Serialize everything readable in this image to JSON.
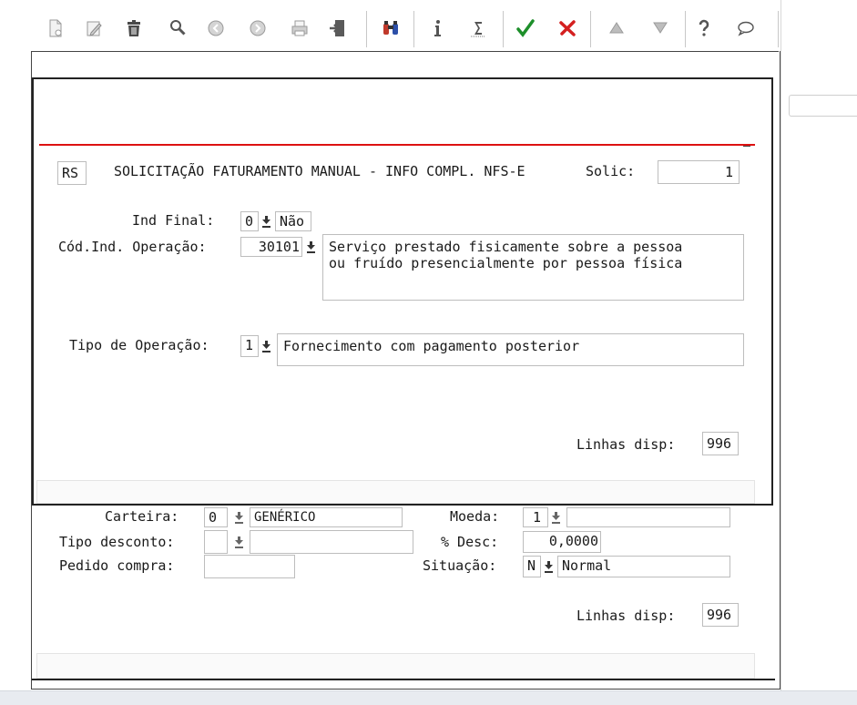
{
  "toolbar": {
    "icons": [
      "new-document-icon",
      "edit-icon",
      "trash-icon",
      "search-icon",
      "previous-icon",
      "next-icon",
      "print-icon",
      "exit-icon",
      "find-binoculars-icon",
      "info-icon",
      "sum-icon",
      "confirm-icon",
      "cancel-icon",
      "up-icon",
      "down-icon",
      "help-icon",
      "comment-icon"
    ]
  },
  "colors": {
    "accent_red": "#dd1111",
    "confirm_green": "#1d8f2a",
    "cancel_red": "#d42020"
  },
  "header": {
    "code": "RS",
    "title": "SOLICITAÇÃO FATURAMENTO MANUAL - INFO COMPL. NFS-E",
    "solic_label": "Solic:",
    "solic_value": "1"
  },
  "form": {
    "ind_final_label": "Ind Final:",
    "ind_final_code": "0",
    "ind_final_desc": "Não",
    "cod_ind_label": "Cód.Ind. Operação:",
    "cod_ind_value": "30101",
    "cod_ind_desc": "Serviço prestado fisicamente sobre a pessoa\nou fruído presencialmente por pessoa física",
    "tipo_op_label": "Tipo de Operação:",
    "tipo_op_code": "1",
    "tipo_op_desc": "Fornecimento com pagamento posterior",
    "linhas_label": "Linhas disp:",
    "linhas_value": "996"
  },
  "lower": {
    "carteira_label": "Carteira:",
    "carteira_code": "0",
    "carteira_desc": "GENÉRICO",
    "moeda_label": "Moeda:",
    "moeda_code": "1",
    "moeda_desc": "",
    "tipo_desc_label": "Tipo desconto:",
    "tipo_desc_code": "",
    "tipo_desc_desc": "",
    "pct_desc_label": "% Desc:",
    "pct_desc_value": "0,0000",
    "pedido_label": "Pedido compra:",
    "pedido_value": "",
    "situacao_label": "Situação:",
    "situacao_code": "N",
    "situacao_desc": "Normal",
    "linhas_label": "Linhas disp:",
    "linhas_value": "996"
  }
}
